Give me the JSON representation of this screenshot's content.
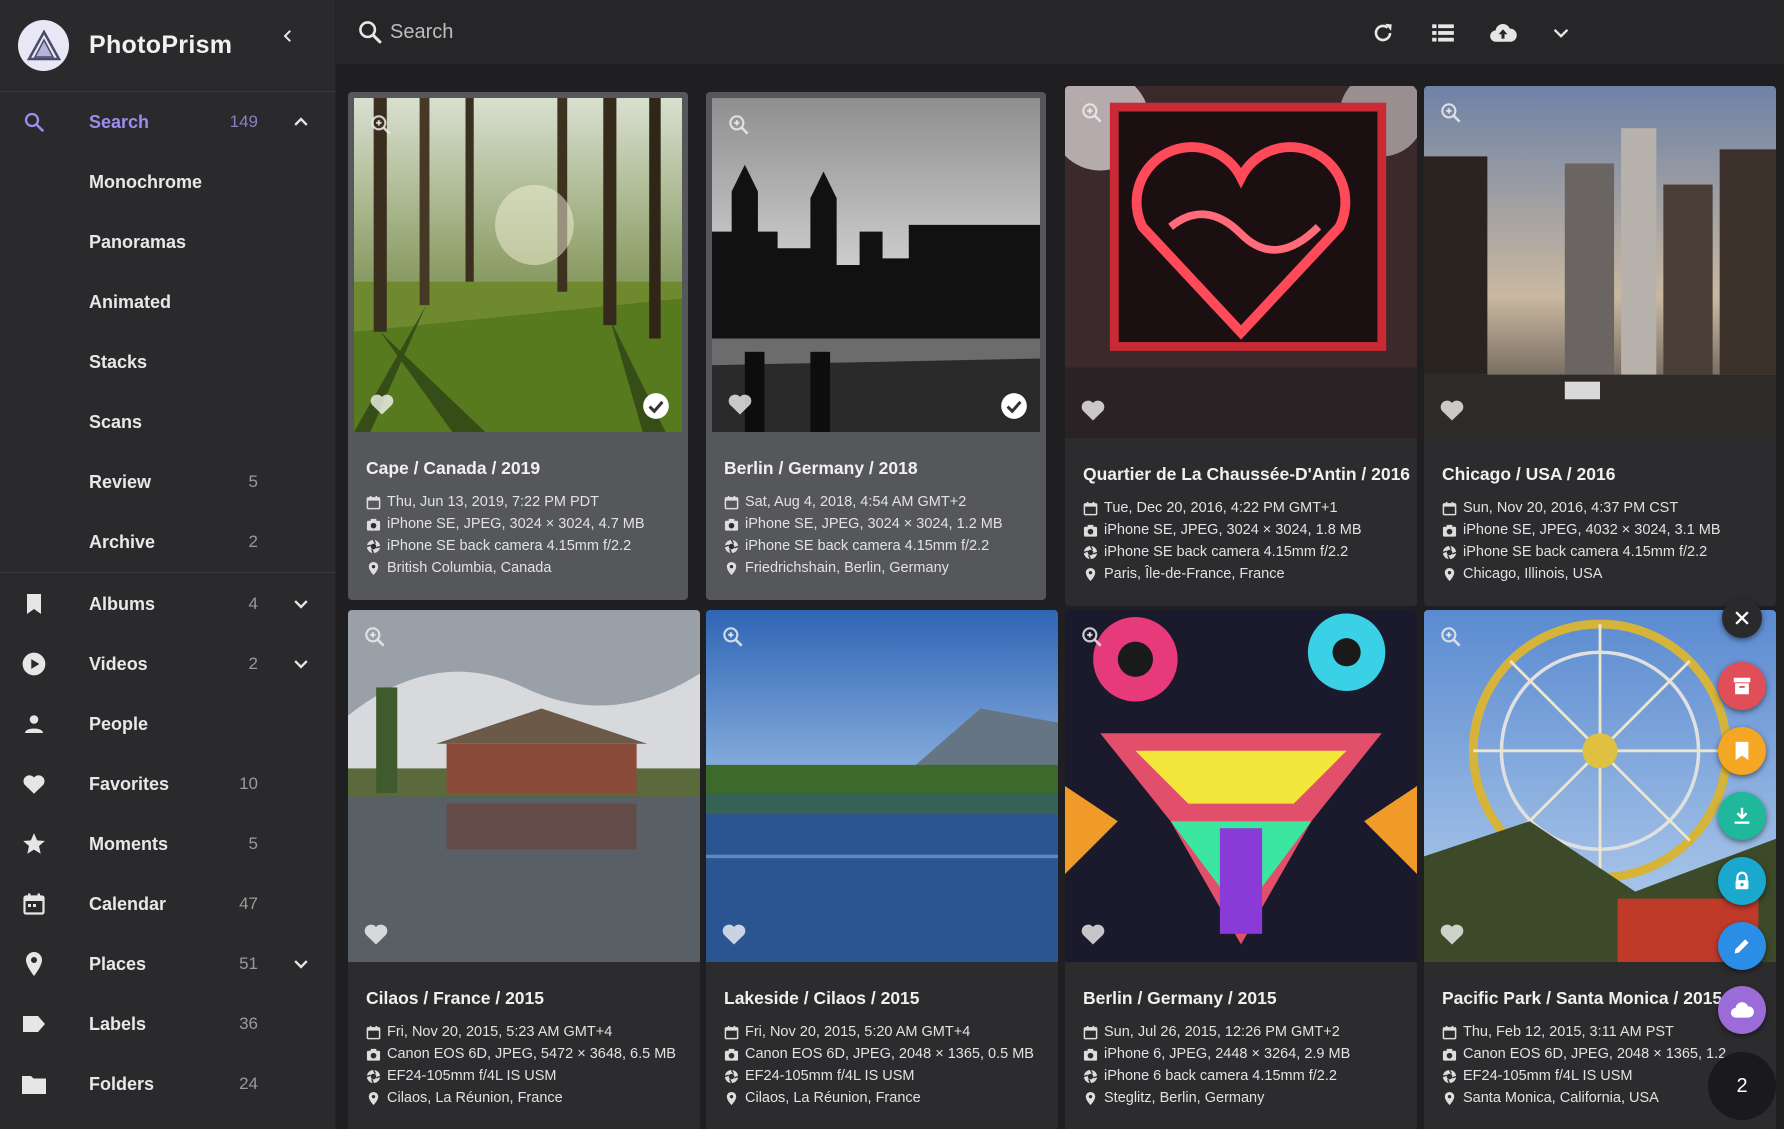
{
  "app": {
    "title": "PhotoPrism"
  },
  "search": {
    "placeholder": "Search",
    "value": ""
  },
  "sidebar": {
    "items": [
      {
        "label": "Search",
        "count": "149",
        "icon": "search-icon",
        "expand": "up"
      },
      {
        "label": "Monochrome",
        "count": ""
      },
      {
        "label": "Panoramas",
        "count": ""
      },
      {
        "label": "Animated",
        "count": ""
      },
      {
        "label": "Stacks",
        "count": ""
      },
      {
        "label": "Scans",
        "count": ""
      },
      {
        "label": "Review",
        "count": "5"
      },
      {
        "label": "Archive",
        "count": "2"
      },
      {
        "label": "Albums",
        "count": "4",
        "icon": "bookmark-icon",
        "expand": "down"
      },
      {
        "label": "Videos",
        "count": "2",
        "icon": "play-circle-icon",
        "expand": "down"
      },
      {
        "label": "People",
        "count": "",
        "icon": "person-icon"
      },
      {
        "label": "Favorites",
        "count": "10",
        "icon": "heart-icon"
      },
      {
        "label": "Moments",
        "count": "5",
        "icon": "star-icon"
      },
      {
        "label": "Calendar",
        "count": "47",
        "icon": "calendar-icon"
      },
      {
        "label": "Places",
        "count": "51",
        "icon": "place-icon",
        "expand": "down"
      },
      {
        "label": "Labels",
        "count": "36",
        "icon": "label-icon"
      },
      {
        "label": "Folders",
        "count": "24",
        "icon": "folder-icon"
      }
    ]
  },
  "toolbar": {
    "icons": [
      "refresh-icon",
      "list-view-icon",
      "upload-icon",
      "chevron-down-icon"
    ]
  },
  "photos": [
    {
      "title": "Cape / Canada / 2019",
      "date": "Thu, Jun 13, 2019, 7:22 PM PDT",
      "file": "iPhone SE, JPEG, 3024 × 3024, 4.7 MB",
      "camera": "iPhone SE back camera 4.15mm f/2.2",
      "location": "British Columbia, Canada",
      "selected": true
    },
    {
      "title": "Berlin / Germany / 2018",
      "date": "Sat, Aug 4, 2018, 4:54 AM GMT+2",
      "file": "iPhone SE, JPEG, 3024 × 3024, 1.2 MB",
      "camera": "iPhone SE back camera 4.15mm f/2.2",
      "location": "Friedrichshain, Berlin, Germany",
      "selected": true
    },
    {
      "title": "Quartier de La Chaussée-D'Antin / 2016",
      "date": "Tue, Dec 20, 2016, 4:22 PM GMT+1",
      "file": "iPhone SE, JPEG, 3024 × 3024, 1.8 MB",
      "camera": "iPhone SE back camera 4.15mm f/2.2",
      "location": "Paris, Île-de-France, France",
      "selected": false
    },
    {
      "title": "Chicago / USA / 2016",
      "date": "Sun, Nov 20, 2016, 4:37 PM CST",
      "file": "iPhone SE, JPEG, 4032 × 3024, 3.1 MB",
      "camera": "iPhone SE back camera 4.15mm f/2.2",
      "location": "Chicago, Illinois, USA",
      "selected": false
    },
    {
      "title": "Cilaos / France / 2015",
      "date": "Fri, Nov 20, 2015, 5:23 AM GMT+4",
      "file": "Canon EOS 6D, JPEG, 5472 × 3648, 6.5 MB",
      "camera": "EF24-105mm f/4L IS USM",
      "location": "Cilaos, La Réunion, France",
      "selected": false
    },
    {
      "title": "Lakeside / Cilaos / 2015",
      "date": "Fri, Nov 20, 2015, 5:20 AM GMT+4",
      "file": "Canon EOS 6D, JPEG, 2048 × 1365, 0.5 MB",
      "camera": "EF24-105mm f/4L IS USM",
      "location": "Cilaos, La Réunion, France",
      "selected": false
    },
    {
      "title": "Berlin / Germany / 2015",
      "date": "Sun, Jul 26, 2015, 12:26 PM GMT+2",
      "file": "iPhone 6, JPEG, 2448 × 3264, 2.9 MB",
      "camera": "iPhone 6 back camera 4.15mm f/2.2",
      "location": "Steglitz, Berlin, Germany",
      "selected": false
    },
    {
      "title": "Pacific Park / Santa Monica / 2015",
      "date": "Thu, Feb 12, 2015, 3:11 AM PST",
      "file": "Canon EOS 6D, JPEG, 2048 × 1365, 1.2",
      "camera": "EF24-105mm f/4L IS USM",
      "location": "Santa Monica, California, USA",
      "selected": false
    }
  ],
  "selection": {
    "count": "2",
    "actions": [
      {
        "name": "close-icon",
        "color": "#2a2a2c"
      },
      {
        "name": "archive-icon",
        "color": "#e04e57"
      },
      {
        "name": "album-icon",
        "color": "#f5a623"
      },
      {
        "name": "download-icon",
        "color": "#1fb89a"
      },
      {
        "name": "private-icon",
        "color": "#1aa8cf"
      },
      {
        "name": "edit-icon",
        "color": "#2a8ee6"
      },
      {
        "name": "share-icon",
        "color": "#9b6cd8"
      }
    ]
  }
}
